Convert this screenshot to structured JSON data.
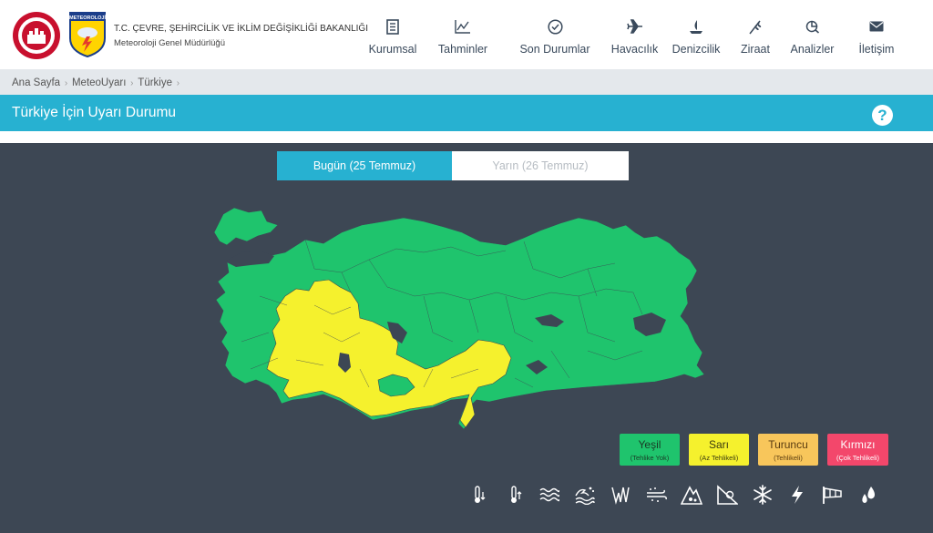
{
  "header": {
    "ministry": "T.C. ÇEVRE, ŞEHİRCİLİK VE İKLİM DEĞİŞİKLİĞİ BAKANLIĞI",
    "directorate": "Meteoroloji Genel Müdürlüğü",
    "logo_text": "METEOROLOJİ"
  },
  "nav": [
    {
      "label": "Kurumsal",
      "icon": "building-icon"
    },
    {
      "label": "Tahminler",
      "icon": "chart-icon"
    },
    {
      "label": "Son Durumlar",
      "icon": "check-circle-icon"
    },
    {
      "label": "Havacılık",
      "icon": "plane-icon"
    },
    {
      "label": "Denizcilik",
      "icon": "sailboat-icon"
    },
    {
      "label": "Ziraat",
      "icon": "wheat-icon"
    },
    {
      "label": "Analizler",
      "icon": "analysis-icon"
    },
    {
      "label": "İletişim",
      "icon": "envelope-icon"
    }
  ],
  "breadcrumb": [
    "Ana Sayfa",
    "MeteoUyarı",
    "Türkiye"
  ],
  "page_title": "Türkiye İçin Uyarı Durumu",
  "help_label": "?",
  "tabs": {
    "today": "Bugün (25 Temmuz)",
    "tomorrow": "Yarın (26 Temmuz)",
    "selected": "today"
  },
  "legend": [
    {
      "name": "Yeşil",
      "desc": "(Tehlike Yok)",
      "color": "#1fc46d"
    },
    {
      "name": "Sarı",
      "desc": "(Az Tehlikeli)",
      "color": "#f5f12d"
    },
    {
      "name": "Turuncu",
      "desc": "(Tehlikeli)",
      "color": "#f8c65b"
    },
    {
      "name": "Kırmızı",
      "desc": "(Çok Tehlikeli)",
      "color": "#f3476b"
    }
  ],
  "map_colors": {
    "green": "#1fc46d",
    "yellow": "#f5f12d",
    "water": "#3d4754"
  },
  "hazards": [
    "cold-icon",
    "heat-icon",
    "wind-waves-icon",
    "storm-surge-icon",
    "fog-icon",
    "dust-icon",
    "avalanche-icon",
    "landslide-icon",
    "snow-icon",
    "lightning-icon",
    "windsock-icon",
    "rain-icon"
  ]
}
